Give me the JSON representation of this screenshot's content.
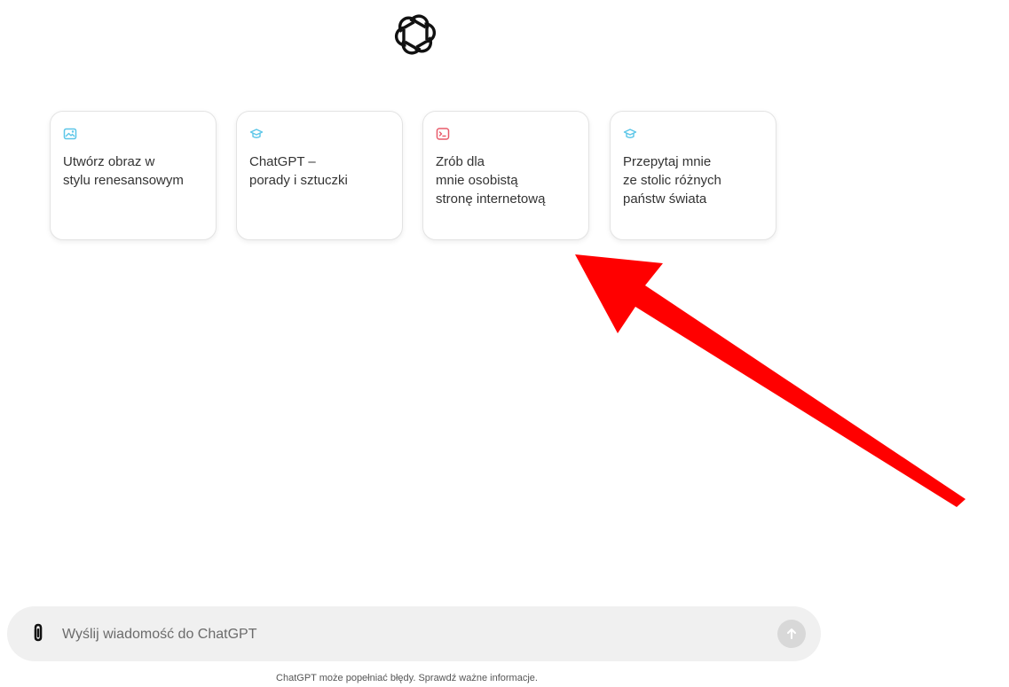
{
  "logo": {
    "icon": "openai-logo-icon"
  },
  "suggestions": [
    {
      "icon": "image-icon",
      "icon_color": "#5bc6e8",
      "lines": [
        "Utwórz obraz w",
        "stylu renesansowym"
      ]
    },
    {
      "icon": "graduation-cap-icon",
      "icon_color": "#5bc6e8",
      "lines": [
        "ChatGPT –",
        "porady i sztuczki"
      ]
    },
    {
      "icon": "terminal-icon",
      "icon_color": "#e85a6a",
      "lines": [
        "Zrób dla",
        "mnie osobistą",
        "stronę internetową"
      ]
    },
    {
      "icon": "graduation-cap-icon",
      "icon_color": "#5bc6e8",
      "lines": [
        "Przepytaj mnie",
        "ze stolic różnych",
        "państw świata"
      ]
    }
  ],
  "annotation": {
    "icon": "red-arrow-annotation",
    "color": "#ff0000"
  },
  "composer": {
    "attach_icon": "paperclip-icon",
    "placeholder": "Wyślij wiadomość do ChatGPT",
    "value": "",
    "send_icon": "arrow-up-icon"
  },
  "footer": {
    "disclaimer": "ChatGPT może popełniać błędy. Sprawdź ważne informacje."
  }
}
